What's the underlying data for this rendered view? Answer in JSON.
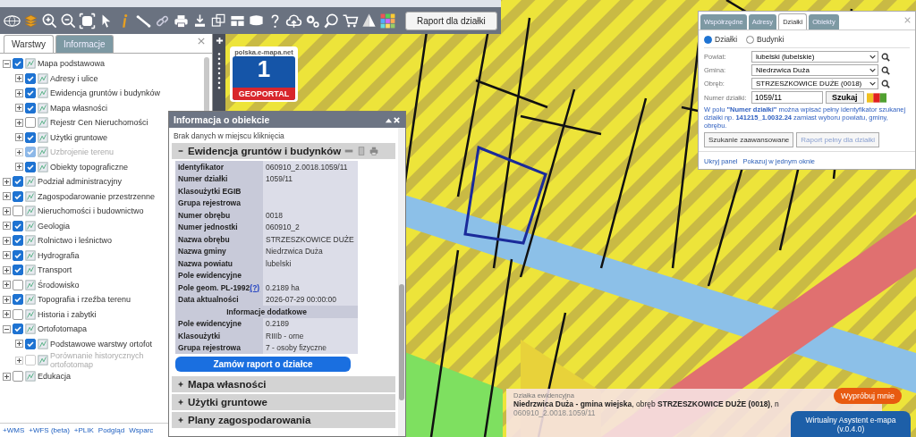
{
  "toolbar": {
    "report_button": "Raport dla działki"
  },
  "left_panel": {
    "tabs": [
      {
        "label": "Warstwy",
        "selected": true
      },
      {
        "label": "Informacje",
        "selected": false
      }
    ],
    "layers": [
      {
        "label": "Mapa podstawowa",
        "checked": true,
        "expanded": true,
        "disabled": false,
        "children": [
          {
            "label": "Adresy i ulice",
            "checked": true,
            "expanded": false,
            "disabled": false
          },
          {
            "label": "Ewidencja gruntów i budynków",
            "checked": true,
            "expanded": false,
            "disabled": false
          },
          {
            "label": "Mapa własności",
            "checked": true,
            "expanded": false,
            "disabled": false
          },
          {
            "label": "Rejestr Cen Nieruchomości",
            "checked": false,
            "expanded": false,
            "disabled": false
          },
          {
            "label": "Użytki gruntowe",
            "checked": true,
            "expanded": false,
            "disabled": false
          },
          {
            "label": "Uzbrojenie terenu",
            "checked": true,
            "expanded": false,
            "disabled": true
          },
          {
            "label": "Obiekty topograficzne",
            "checked": true,
            "expanded": false,
            "disabled": false
          }
        ]
      },
      {
        "label": "Podział administracyjny",
        "checked": true,
        "expanded": false,
        "disabled": false
      },
      {
        "label": "Zagospodarowanie przestrzenne",
        "checked": true,
        "expanded": false,
        "disabled": false
      },
      {
        "label": "Nieruchomości i budownictwo",
        "checked": false,
        "expanded": false,
        "disabled": false
      },
      {
        "label": "Geologia",
        "checked": true,
        "expanded": false,
        "disabled": false
      },
      {
        "label": "Rolnictwo i leśnictwo",
        "checked": true,
        "expanded": false,
        "disabled": false
      },
      {
        "label": "Hydrografia",
        "checked": true,
        "expanded": false,
        "disabled": false
      },
      {
        "label": "Transport",
        "checked": true,
        "expanded": false,
        "disabled": false
      },
      {
        "label": "Środowisko",
        "checked": false,
        "expanded": false,
        "disabled": false
      },
      {
        "label": "Topografia i rzeźba terenu",
        "checked": true,
        "expanded": false,
        "disabled": false
      },
      {
        "label": "Historia i zabytki",
        "checked": false,
        "expanded": false,
        "disabled": false
      },
      {
        "label": "Ortofotomapa",
        "checked": true,
        "expanded": true,
        "disabled": false,
        "children": [
          {
            "label": "Podstawowe warstwy ortofot",
            "checked": true,
            "expanded": false,
            "disabled": false
          },
          {
            "label": "Porównanie historycznych ortofotomap",
            "checked": false,
            "expanded": false,
            "disabled": true
          }
        ]
      },
      {
        "label": "Edukacja",
        "checked": false,
        "expanded": false,
        "disabled": false
      }
    ],
    "links": [
      "+WMS",
      "+WFS (beta)",
      "+PLIK",
      "Podgląd",
      "Wsparc"
    ]
  },
  "logo": {
    "site": "polska.e-mapa.net",
    "number": "1",
    "name": "GEOPORTAL"
  },
  "info_popup": {
    "title": "Informacja o obiekcie",
    "message": "Brak danych w miejscu kliknięcia",
    "sections": [
      {
        "title": "Ewidencja gruntów i budynków",
        "expanded": true,
        "rows": [
          {
            "kind": "row",
            "label": "Identyfikator",
            "value": "060910_2.0018.1059/11"
          },
          {
            "kind": "row",
            "label": "Numer działki",
            "value": "1059/11"
          },
          {
            "kind": "row",
            "label": "Klasoużytki EGIB"
          },
          {
            "kind": "row",
            "label": "Grupa rejestrowa"
          },
          {
            "kind": "row",
            "label": "Numer obrębu",
            "value": "0018"
          },
          {
            "kind": "row",
            "label": "Numer jednostki",
            "value": "060910_2"
          },
          {
            "kind": "row",
            "label": "Nazwa obrębu",
            "value": "STRZESZKOWICE DUŻE"
          },
          {
            "kind": "row",
            "label": "Nazwa gminy",
            "value": "Niedrzwica Duża"
          },
          {
            "kind": "row",
            "label": "Nazwa powiatu",
            "value": "lubelski"
          },
          {
            "kind": "row",
            "label": "Pole ewidencyjne"
          },
          {
            "kind": "row",
            "label": "Pole geom. PL-1992",
            "link": "(?)",
            "value": "0.2189 ha"
          },
          {
            "kind": "row",
            "label": "Data aktualności",
            "value": "2026-07-29 00:00:00"
          },
          {
            "kind": "header",
            "label": "Informacje dodatkowe"
          },
          {
            "kind": "row",
            "label": "Pole ewidencyjne",
            "value": "0.2189"
          },
          {
            "kind": "row",
            "label": "Klasoużytki",
            "value": "RIIIb - orne"
          },
          {
            "kind": "row",
            "label": "Grupa rejestrowa",
            "value": "7 - osoby fizyczne"
          }
        ],
        "button": "Zamów raport o działce"
      },
      {
        "title": "Mapa własności",
        "expanded": false
      },
      {
        "title": "Użytki gruntowe",
        "expanded": false
      },
      {
        "title": "Plany zagospodarowania",
        "expanded": false
      }
    ]
  },
  "search_panel": {
    "tabs": [
      {
        "label": "Współrzędne",
        "selected": false
      },
      {
        "label": "Adresy",
        "selected": false
      },
      {
        "label": "Działki",
        "selected": true
      },
      {
        "label": "Obiekty",
        "selected": false
      }
    ],
    "radios": [
      {
        "label": "Działki",
        "selected": true
      },
      {
        "label": "Budynki",
        "selected": false
      }
    ],
    "fields": [
      {
        "kind": "select",
        "label": "Powiat:",
        "value": "lubelski (lubelskie)"
      },
      {
        "kind": "select",
        "label": "Gmina:",
        "value": "Niedrzwica Duża"
      },
      {
        "kind": "select",
        "label": "Obręb:",
        "value": "STRZESZKOWICE DUŻE (0018)"
      },
      {
        "kind": "input",
        "label": "Numer działki:",
        "value": "1059/11",
        "button": "Szukaj"
      }
    ],
    "hint": "W polu **\"Numer działki\"** można wpisać pełny identyfikator szukanej działki np. **141215_1.0032.24** zamiast wyboru powiatu, gminy, obrębu.",
    "buttons": [
      {
        "label": "Szukanie zaawansowane",
        "disabled": false
      },
      {
        "label": "Raport pełny dla działki",
        "disabled": true
      }
    ],
    "links": [
      "Ukryj panel",
      "Pokazuj w jednym oknie"
    ]
  },
  "parcel_info": {
    "label": "Działka ewidencyjna",
    "text": "**Niedrzwica Duża - gmina wiejska**, obręb **STRZESZKOWICE DUŻE (0018)**, n",
    "id": "060910_2.0018.1059/11"
  },
  "assistant": {
    "try_button": "Wypróbuj mnie",
    "title": "Wirtualny Asystent e-mapa",
    "version": "(v.0.4.0)"
  }
}
